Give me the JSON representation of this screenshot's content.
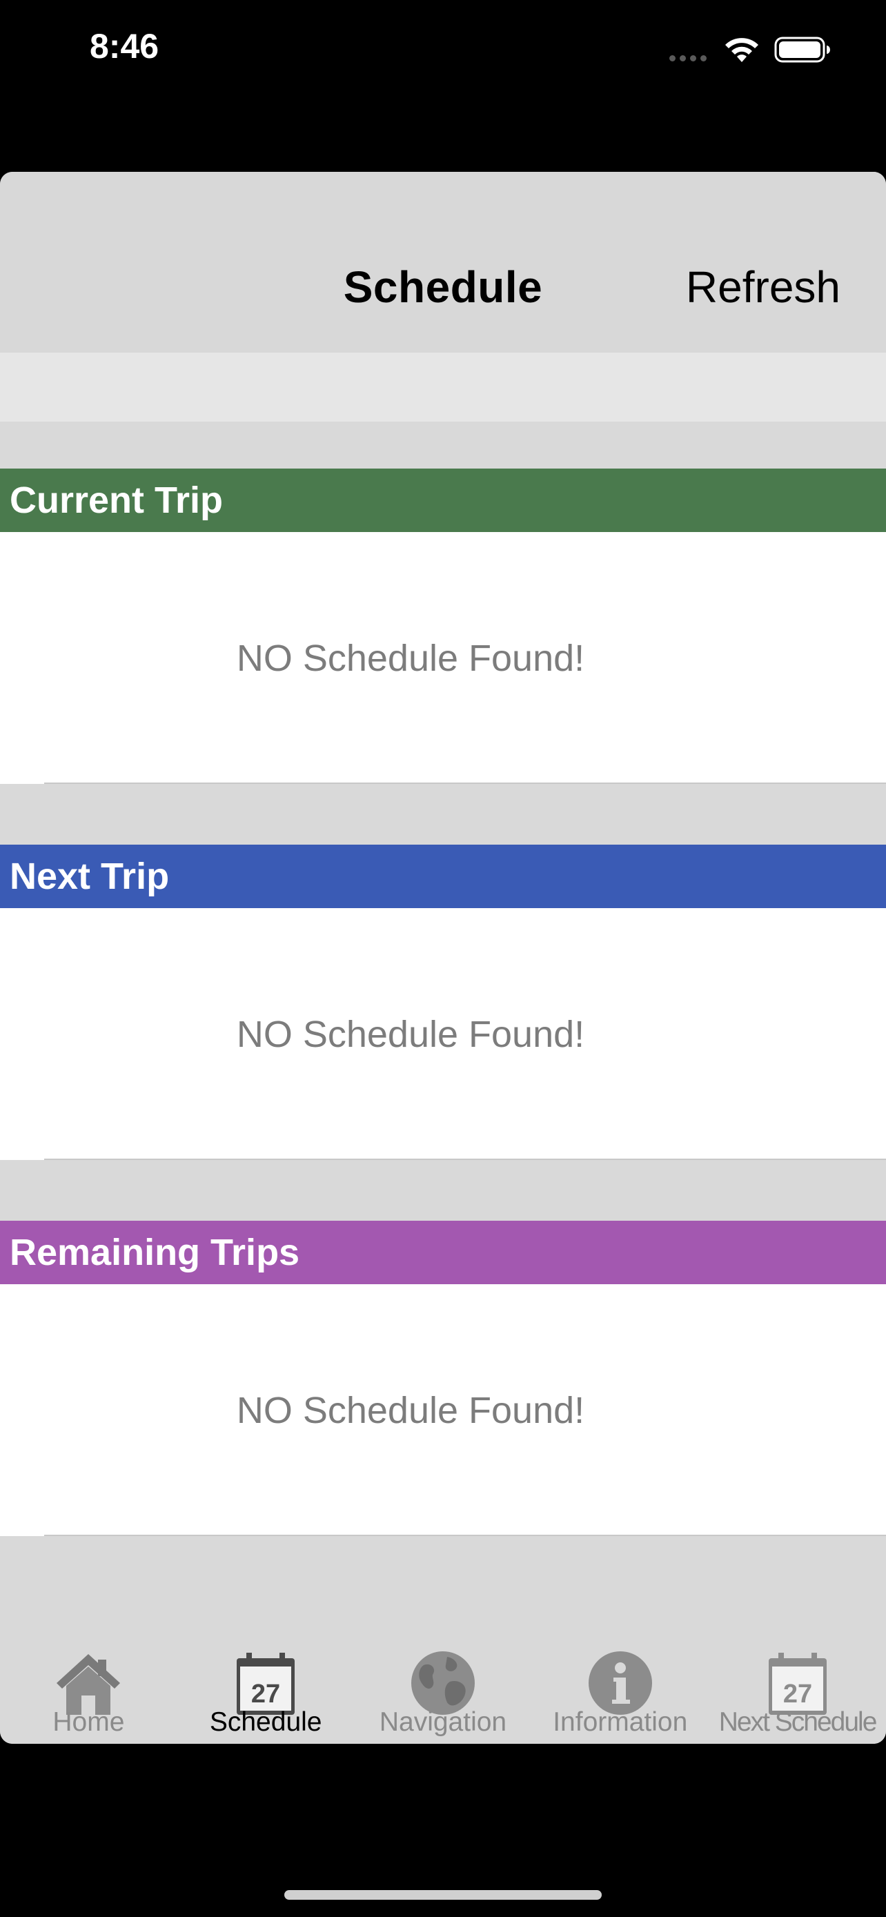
{
  "status_bar": {
    "time": "8:46"
  },
  "nav": {
    "title": "Schedule",
    "refresh_label": "Refresh"
  },
  "sections": [
    {
      "title": "Current Trip",
      "color": "#4a7a4d",
      "empty_text": "NO Schedule Found!"
    },
    {
      "title": "Next Trip",
      "color": "#3a5bb5",
      "empty_text": "NO Schedule Found!"
    },
    {
      "title": "Remaining Trips",
      "color": "#a358b0",
      "empty_text": "NO Schedule Found!"
    }
  ],
  "tabs": [
    {
      "label": "Home",
      "icon": "home-icon",
      "active": false
    },
    {
      "label": "Schedule",
      "icon": "calendar-icon",
      "active": true,
      "calendar_day": "27"
    },
    {
      "label": "Navigation",
      "icon": "globe-icon",
      "active": false
    },
    {
      "label": "Information",
      "icon": "info-icon",
      "active": false
    },
    {
      "label": "Next Schedule",
      "icon": "calendar-icon",
      "active": false,
      "calendar_day": "27"
    }
  ]
}
